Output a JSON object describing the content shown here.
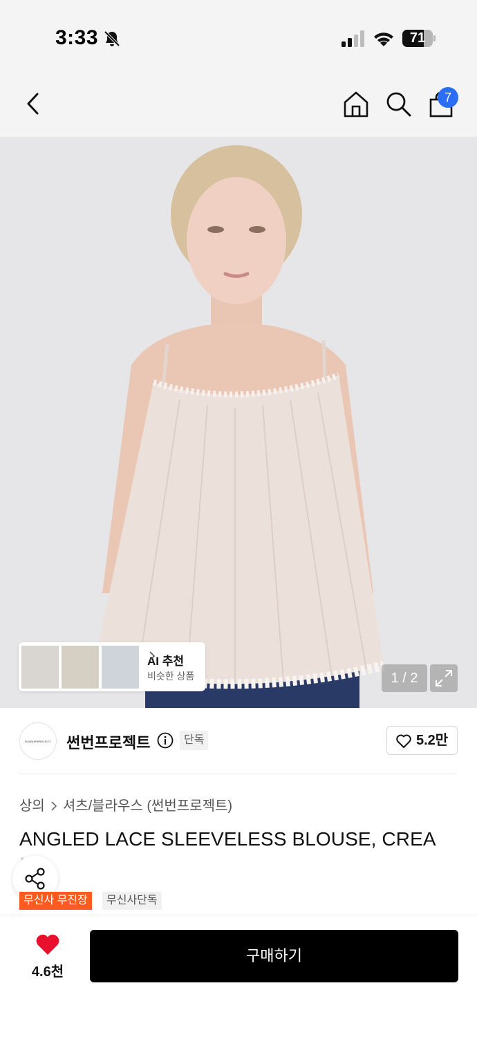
{
  "status_bar": {
    "time": "3:33",
    "battery": "71",
    "battery_level": 0.71,
    "icons": [
      "bell-slash-icon",
      "cellular-signal-icon",
      "wifi-icon",
      "battery-icon"
    ]
  },
  "nav": {
    "icons": [
      "back-chevron-icon",
      "home-icon",
      "search-icon",
      "shopping-bag-icon"
    ],
    "cart_count": "7"
  },
  "gallery": {
    "counter": "1 / 2",
    "ai_title": "AI 추천",
    "ai_subtitle": "비슷한 상품",
    "icons": [
      "expand-icon",
      "chevron-right-icon"
    ]
  },
  "brand": {
    "logo_text": "SUNBURNPROJECT",
    "name": "썬번프로젝트",
    "tag": "단독",
    "likes": "5.2만",
    "icons": [
      "info-icon",
      "heart-outline-icon"
    ]
  },
  "product": {
    "breadcrumb": [
      "상의",
      "셔츠/블라우스 (썬번프로젝트)"
    ],
    "title_line1": "ANGLED LACE SLEEVELESS BLOUSE, CREA",
    "title_line2": "M",
    "badges": [
      "무신사 무진장",
      "무신사단독"
    ]
  },
  "share": {
    "icon": "share-icon"
  },
  "bottom_bar": {
    "wish_count": "4.6천",
    "buy_label": "구매하기",
    "icons": [
      "heart-filled-icon"
    ],
    "accent_color": "#e8102d"
  },
  "colors": {
    "badge_orange": "#ff5a1f",
    "cart_badge": "#2b6ef5",
    "buy_button": "#000000"
  }
}
